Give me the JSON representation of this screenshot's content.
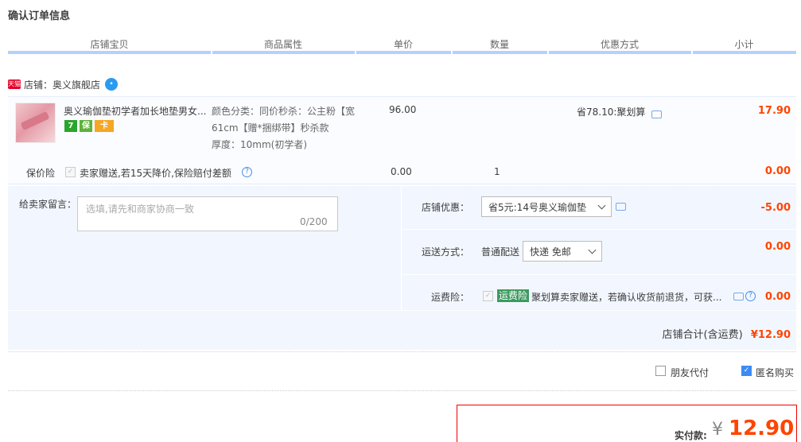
{
  "page_title": "确认订单信息",
  "columns": [
    "店铺宝贝",
    "商品属性",
    "单价",
    "数量",
    "优惠方式",
    "小计"
  ],
  "shop": {
    "badge": "天猫",
    "label": "店铺：奥义旗舰店"
  },
  "item": {
    "name": "奥义瑜伽垫初学者加长地垫男女...",
    "badges": [
      "7",
      "保",
      "卡"
    ],
    "attrs": [
      "颜色分类：同价秒杀：公主粉【宽",
      "61cm【赠*捆绑带】秒杀款",
      "厚度：10mm(初学者)"
    ],
    "unit_price": "96.00",
    "discount": "省78.10:聚划算",
    "subtotal": "17.90"
  },
  "insurance": {
    "label": "保价险",
    "text": "卖家赠送,若15天降价,保险赔付差额",
    "price": "0.00",
    "quantity": "1",
    "subtotal": "0.00"
  },
  "memo": {
    "label": "给卖家留言：",
    "placeholder": "选填,请先和商家协商一致",
    "counter": "0/200"
  },
  "shop_discount": {
    "label": "店铺优惠：",
    "value": "省5元:14号奥义瑜伽垫",
    "amount": "-5.00"
  },
  "shipping": {
    "label": "运送方式：",
    "method": "普通配送",
    "value": "快递 免邮",
    "amount": "0.00"
  },
  "freight_insurance": {
    "label": "运费险：",
    "tag": "运费险",
    "text": "聚划算卖家赠送，若确认收货前退货，可获...",
    "amount": "0.00"
  },
  "shop_total": {
    "label": "店铺合计(含运费)",
    "amount": "¥12.90"
  },
  "options": {
    "friend_pay": "朋友代付",
    "anonymous": "匿名购买"
  },
  "payment": {
    "label": "实付款:",
    "currency": "¥",
    "amount": "12.90"
  },
  "colors": {
    "accent_red": "#ff4400",
    "header_blue": "#b2d1ff",
    "panel_blue": "#f2f7ff"
  }
}
